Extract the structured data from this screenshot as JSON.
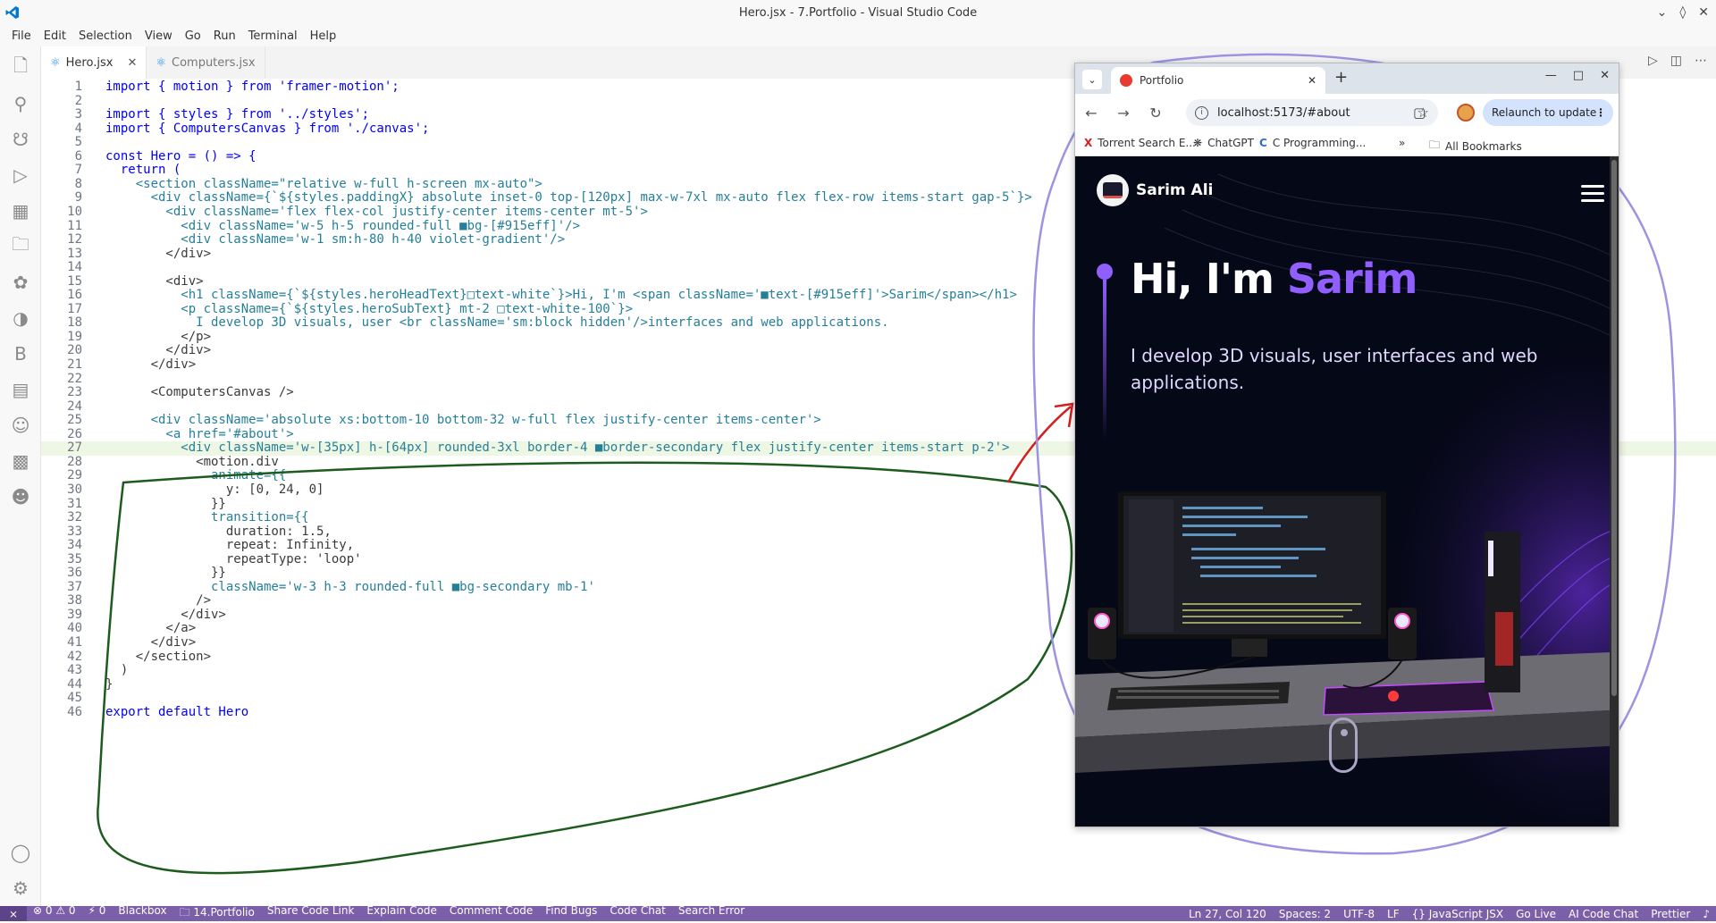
{
  "window": {
    "title": "Hero.jsx - 7.Portfolio - Visual Studio Code"
  },
  "menu": [
    "File",
    "Edit",
    "Selection",
    "View",
    "Go",
    "Run",
    "Terminal",
    "Help"
  ],
  "tabs": [
    {
      "label": "Hero.jsx",
      "active": true
    },
    {
      "label": "Computers.jsx",
      "active": false
    }
  ],
  "code_lines": [
    {
      "n": "1",
      "text": "import { motion } from 'framer-motion';"
    },
    {
      "n": "2",
      "text": ""
    },
    {
      "n": "3",
      "text": "import { styles } from '../styles';"
    },
    {
      "n": "4",
      "text": "import { ComputersCanvas } from './canvas';"
    },
    {
      "n": "5",
      "text": ""
    },
    {
      "n": "6",
      "text": "const Hero = () => {"
    },
    {
      "n": "7",
      "text": "  return ("
    },
    {
      "n": "8",
      "text": "    <section className=\"relative w-full h-screen mx-auto\">"
    },
    {
      "n": "9",
      "text": "      <div className={`${styles.paddingX} absolute inset-0 top-[120px] max-w-7xl mx-auto flex flex-row items-start gap-5`}>"
    },
    {
      "n": "10",
      "text": "        <div className='flex flex-col justify-center items-center mt-5'>"
    },
    {
      "n": "11",
      "text": "          <div className='w-5 h-5 rounded-full ■bg-[#915eff]'/>"
    },
    {
      "n": "12",
      "text": "          <div className='w-1 sm:h-80 h-40 violet-gradient'/>"
    },
    {
      "n": "13",
      "text": "        </div>"
    },
    {
      "n": "14",
      "text": ""
    },
    {
      "n": "15",
      "text": "        <div>"
    },
    {
      "n": "16",
      "text": "          <h1 className={`${styles.heroHeadText}□text-white`}>Hi, I'm <span className='■text-[#915eff]'>Sarim</span></h1>"
    },
    {
      "n": "17",
      "text": "          <p className={`${styles.heroSubText} mt-2 □text-white-100`}>"
    },
    {
      "n": "18",
      "text": "            I develop 3D visuals, user <br className='sm:block hidden'/>interfaces and web applications."
    },
    {
      "n": "19",
      "text": "          </p>"
    },
    {
      "n": "20",
      "text": "        </div>"
    },
    {
      "n": "21",
      "text": "      </div>"
    },
    {
      "n": "22",
      "text": ""
    },
    {
      "n": "23",
      "text": "      <ComputersCanvas />"
    },
    {
      "n": "24",
      "text": ""
    },
    {
      "n": "25",
      "text": "      <div className='absolute xs:bottom-10 bottom-32 w-full flex justify-center items-center'>"
    },
    {
      "n": "26",
      "text": "        <a href='#about'>"
    },
    {
      "n": "27",
      "text": "          <div className='w-[35px] h-[64px] rounded-3xl border-4 ■border-secondary flex justify-center items-start p-2'>"
    },
    {
      "n": "28",
      "text": "            <motion.div"
    },
    {
      "n": "29",
      "text": "              animate={{"
    },
    {
      "n": "30",
      "text": "                y: [0, 24, 0]"
    },
    {
      "n": "31",
      "text": "              }}"
    },
    {
      "n": "32",
      "text": "              transition={{"
    },
    {
      "n": "33",
      "text": "                duration: 1.5,"
    },
    {
      "n": "34",
      "text": "                repeat: Infinity,"
    },
    {
      "n": "35",
      "text": "                repeatType: 'loop'"
    },
    {
      "n": "36",
      "text": "              }}"
    },
    {
      "n": "37",
      "text": "              className='w-3 h-3 rounded-full ■bg-secondary mb-1'"
    },
    {
      "n": "38",
      "text": "            />"
    },
    {
      "n": "39",
      "text": "          </div>"
    },
    {
      "n": "40",
      "text": "        </a>"
    },
    {
      "n": "41",
      "text": "      </div>"
    },
    {
      "n": "42",
      "text": "    </section>"
    },
    {
      "n": "43",
      "text": "  )"
    },
    {
      "n": "44",
      "text": "}"
    },
    {
      "n": "45",
      "text": ""
    },
    {
      "n": "46",
      "text": "export default Hero"
    }
  ],
  "highlighted_line": "27",
  "status": {
    "left": [
      "⊗ 0 ⚠ 0",
      "⚡ 0",
      "Blackbox",
      "🗀 14.Portfolio",
      "Share Code Link",
      "Explain Code",
      "Comment Code",
      "Find Bugs",
      "Code Chat",
      "Search Error"
    ],
    "right": [
      "Ln 27, Col 120",
      "Spaces: 2",
      "UTF-8",
      "LF",
      "{} JavaScript JSX",
      "Go Live",
      "AI Code Chat",
      "Prettier"
    ]
  },
  "browser": {
    "tab_title": "Portfolio",
    "url": "localhost:5173/#about",
    "relaunch_label": "Relaunch to update",
    "bookmarks": [
      "Torrent Search E...",
      "ChatGPT",
      "C Programming...",
      "»",
      "All Bookmarks"
    ],
    "site": {
      "name": "Sarim Ali",
      "greeting": "Hi, I'm ",
      "highlight_name": "Sarim",
      "subtitle": "I develop 3D visuals, user interfaces and web applications."
    }
  },
  "colors": {
    "accent": "#915eff",
    "statusbar": "#7b5fa8",
    "hero_bg": "#050816"
  }
}
